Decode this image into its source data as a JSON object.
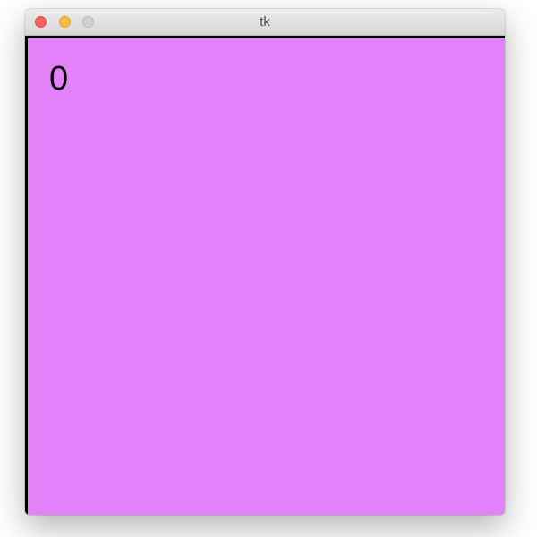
{
  "window": {
    "title": "tk"
  },
  "canvas": {
    "background_color": "#e382fa",
    "counter_text": "0"
  },
  "icons": {
    "close": "close-icon",
    "minimize": "minimize-icon",
    "zoom": "zoom-icon"
  }
}
